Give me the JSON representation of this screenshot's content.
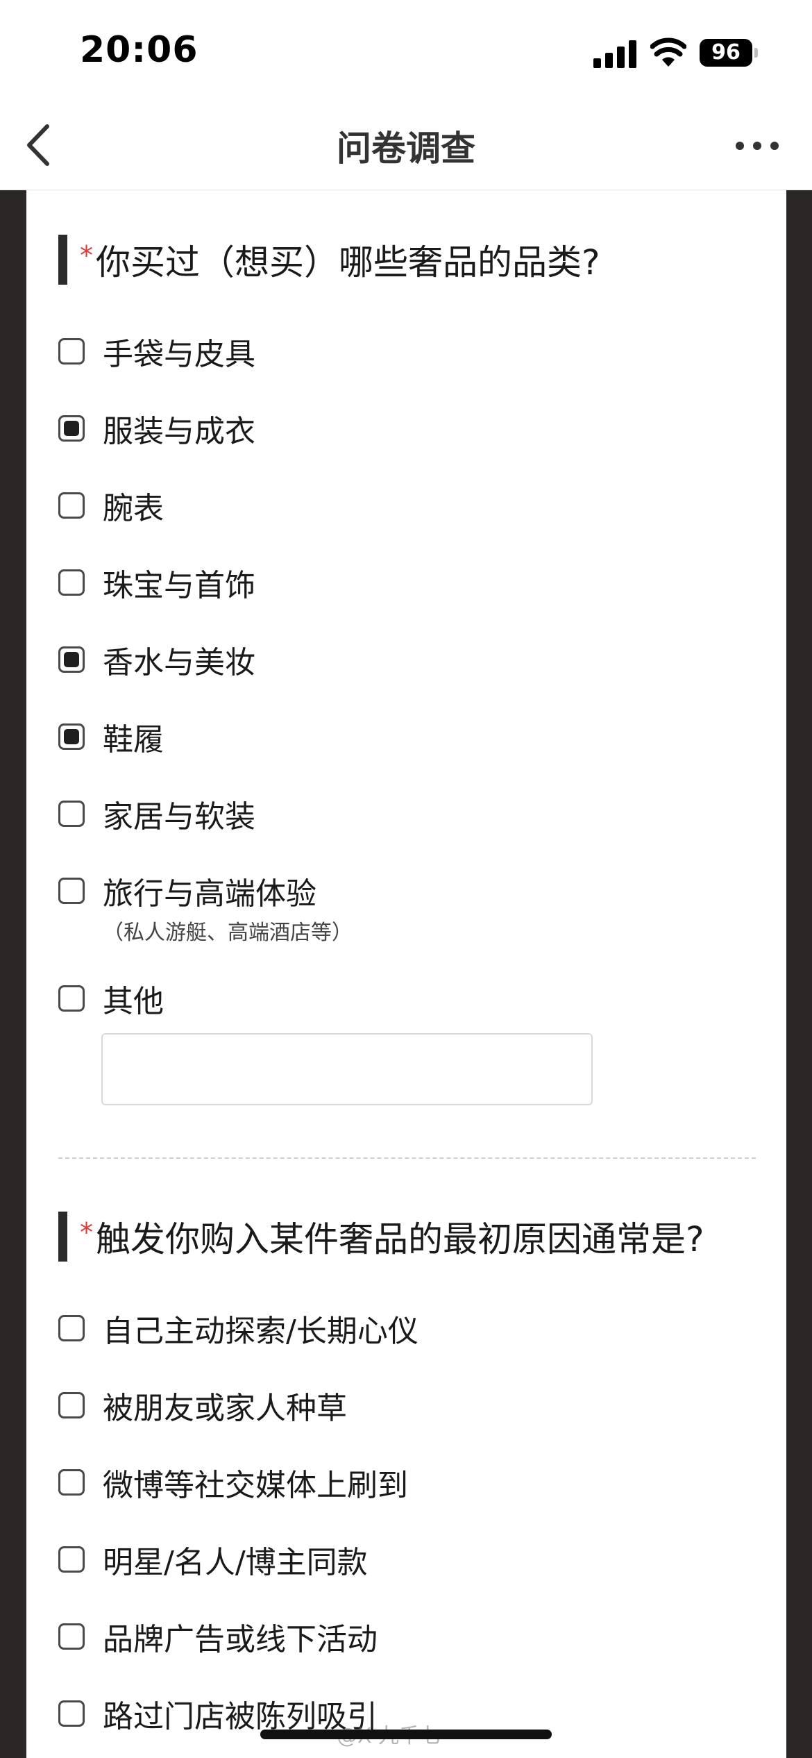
{
  "status_bar": {
    "time": "20:06",
    "battery": "96"
  },
  "nav": {
    "title": "问卷调查"
  },
  "question1": {
    "required_mark": "*",
    "title": "你买过（想买）哪些奢品的品类?",
    "options": [
      {
        "label": "手袋与皮具",
        "checked": false
      },
      {
        "label": "服装与成衣",
        "checked": true
      },
      {
        "label": "腕表",
        "checked": false
      },
      {
        "label": "珠宝与首饰",
        "checked": false
      },
      {
        "label": "香水与美妆",
        "checked": true
      },
      {
        "label": "鞋履",
        "checked": true
      },
      {
        "label": "家居与软装",
        "checked": false
      },
      {
        "label": "旅行与高端体验",
        "checked": false,
        "sublabel": "（私人游艇、高端酒店等）"
      },
      {
        "label": "其他",
        "checked": false
      }
    ],
    "other_input_value": ""
  },
  "question2": {
    "required_mark": "*",
    "title": "触发你购入某件奢品的最初原因通常是?",
    "options": [
      {
        "label": "自己主动探索/长期心仪",
        "checked": false
      },
      {
        "label": "被朋友或家人种草",
        "checked": false
      },
      {
        "label": "微博等社交媒体上刷到",
        "checked": false
      },
      {
        "label": "明星/名人/博主同款",
        "checked": false
      },
      {
        "label": "品牌广告或线下活动",
        "checked": false
      },
      {
        "label": "路过门店被陈列吸引",
        "checked": false
      }
    ]
  },
  "watermark": "@X-九千七",
  "icons": {
    "back": "chevron-left-icon",
    "more": "more-horizontal-icon",
    "signal": "cellular-signal-icon",
    "wifi": "wifi-icon",
    "battery": "battery-icon"
  },
  "colors": {
    "required": "#e53935",
    "frame": "#2b2727",
    "checkbox_fill": "#1f1f1f"
  }
}
